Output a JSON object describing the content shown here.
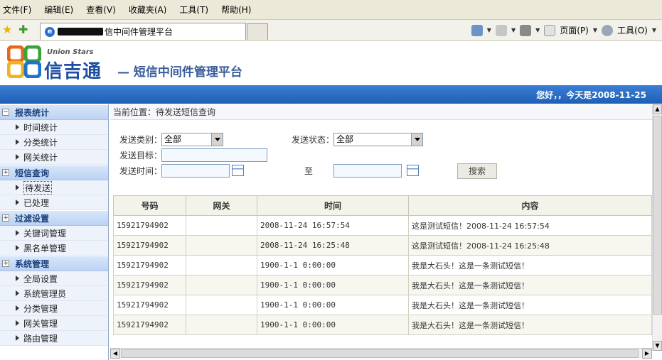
{
  "browser": {
    "menu": [
      "文件(F)",
      "编辑(E)",
      "查看(V)",
      "收藏夹(A)",
      "工具(T)",
      "帮助(H)"
    ],
    "tab_title": "信中间件管理平台",
    "tools": {
      "page": "页面(P)",
      "tools": "工具(O)"
    }
  },
  "header": {
    "logo_en": "Union Stars",
    "logo_cn": "信吉通",
    "platform_title": "— 短信中间件管理平台",
    "greeting": "您好，，今天是2008-11-25"
  },
  "sidebar": {
    "groups": [
      {
        "toggle": "−",
        "label": "报表统计",
        "items": [
          "时间统计",
          "分类统计",
          "网关统计"
        ]
      },
      {
        "toggle": "+",
        "label": "短信查询",
        "items": [
          "待发送",
          "已处理"
        ]
      },
      {
        "toggle": "+",
        "label": "过滤设置",
        "items": [
          "关键词管理",
          "黑名单管理"
        ]
      },
      {
        "toggle": "+",
        "label": "系统管理",
        "items": [
          "全局设置",
          "系统管理员",
          "分类管理",
          "网关管理",
          "路由管理"
        ]
      }
    ],
    "active_item": "待发送"
  },
  "location": "当前位置：待发送短信查询",
  "form": {
    "type_label": "发送类别：",
    "type_value": "全部",
    "status_label": "发送状态：",
    "status_value": "全部",
    "target_label": "发送目标：",
    "time_label": "发送时间：",
    "to_label": "至",
    "search_button": "搜索"
  },
  "table": {
    "headers": [
      "号码",
      "网关",
      "时间",
      "内容"
    ],
    "rows": [
      [
        "15921794902",
        "",
        "2008-11-24 16:57:54",
        "这是测试短信！2008-11-24 16:57:54"
      ],
      [
        "15921794902",
        "",
        "2008-11-24 16:25:48",
        "这是测试短信！2008-11-24 16:25:48"
      ],
      [
        "15921794902",
        "",
        "1900-1-1 0:00:00",
        "我是大石头！这是一条测试短信！"
      ],
      [
        "15921794902",
        "",
        "1900-1-1 0:00:00",
        "我是大石头！这是一条测试短信！"
      ],
      [
        "15921794902",
        "",
        "1900-1-1 0:00:00",
        "我是大石头！这是一条测试短信！"
      ],
      [
        "15921794902",
        "",
        "1900-1-1 0:00:00",
        "我是大石头！这是一条测试短信！"
      ]
    ]
  },
  "colors": {
    "brand_blue": "#1f4fa3",
    "header_bar": "#1f5fb6",
    "sidebar_group": "#bcd3f3"
  }
}
